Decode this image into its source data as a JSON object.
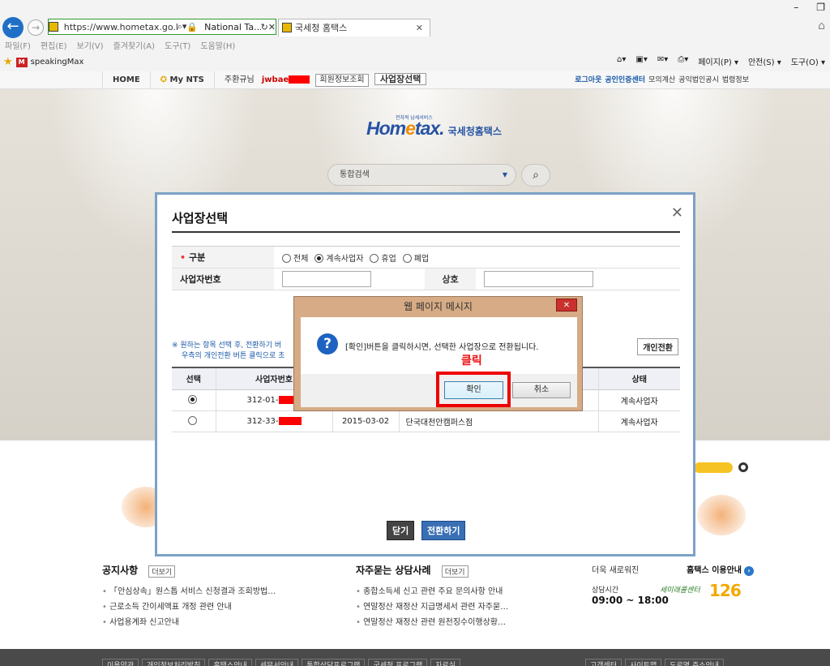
{
  "browser": {
    "url": "https://www.hometax.go.kr/we",
    "site_name": "National Ta...",
    "tab_title": "국세청 홈택스",
    "menu": [
      "파일(F)",
      "편집(E)",
      "보기(V)",
      "즐겨찾기(A)",
      "도구(T)",
      "도움말(H)"
    ],
    "favorite": "speakingMax",
    "commands": [
      "페이지(P) ▾",
      "안전(S) ▾",
      "도구(O) ▾"
    ]
  },
  "sitebar": {
    "home": "HOME",
    "mynts": "My NTS",
    "user_label": "주환규님",
    "user_id": "jwbae",
    "member_info": "회원정보조회",
    "biz_select": "사업장선택",
    "right_links": [
      "로그아웃",
      "공인인증센터",
      "모의계산",
      "공익법인공시",
      "법령정보"
    ]
  },
  "hero": {
    "logo_small": "전자적 납세서비스",
    "logo_main_a": "Hom",
    "logo_main_b": "e",
    "logo_main_c": "tax.",
    "logo_kr": "국세청홈택스",
    "search_label": "통합검색"
  },
  "modal": {
    "title": "사업장선택",
    "form": {
      "type_label": "구분",
      "type_options": [
        "전체",
        "계속사업자",
        "휴업",
        "폐업"
      ],
      "type_selected": 1,
      "biz_no_label": "사업자번호",
      "name_label": "상호"
    },
    "hint_line1": "※ 원하는 항목 선택 후, 전환하기 버",
    "hint_line2": "우측의 개인전환 버튼 클릭으로 초",
    "personal_button": "개인전환",
    "columns": [
      "선택",
      "사업자번호",
      "",
      "",
      "상태"
    ],
    "rows": [
      {
        "selected": true,
        "biz_no": "312-01-",
        "date": "",
        "name": "",
        "status": "계속사업자"
      },
      {
        "selected": false,
        "biz_no": "312-33-",
        "date": "2015-03-02",
        "name": "단국대천안캠퍼스점",
        "status": "계속사업자"
      }
    ],
    "close_button": "닫기",
    "switch_button": "전환하기"
  },
  "dialog": {
    "caption": "웹 페이지 메시지",
    "message": "[확인]버튼을 클릭하시면, 선택한 사업장으로 전환됩니다.",
    "ok": "확인",
    "cancel": "취소",
    "annotation": "클릭"
  },
  "notices": {
    "title": "공지사항",
    "more": "더보기",
    "items": [
      "「안심상속」원스톱 서비스 신청결과 조회방법…",
      "근로소득 간이세액표 개정 관련 안내",
      "사업용계좌 신고안내"
    ]
  },
  "faq": {
    "title": "자주묻는 상담사례",
    "more": "더보기",
    "items": [
      "종합소득세 신고 관련 주요 문의사항 안내",
      "연말정산 재정산 지급명세서 관련 자주묻…",
      "연말정산 재정산 관련 원천징수이행상황…"
    ]
  },
  "info": {
    "label": "더욱 새로워진",
    "link": "홈택스 이용안내",
    "hours_label": "상담시간",
    "hours": "09:00 ~ 18:00",
    "tel_label": "세미래콜센터",
    "tel": "126"
  },
  "footer": {
    "links": [
      "이용약관",
      "개인정보처리방침",
      "홈택스안내",
      "세무서안내",
      "통합상담프로그램",
      "국세청 프로그램",
      "자료실"
    ],
    "links2": [
      "고객센터",
      "사이트맵",
      "도로명 주소안내"
    ]
  }
}
